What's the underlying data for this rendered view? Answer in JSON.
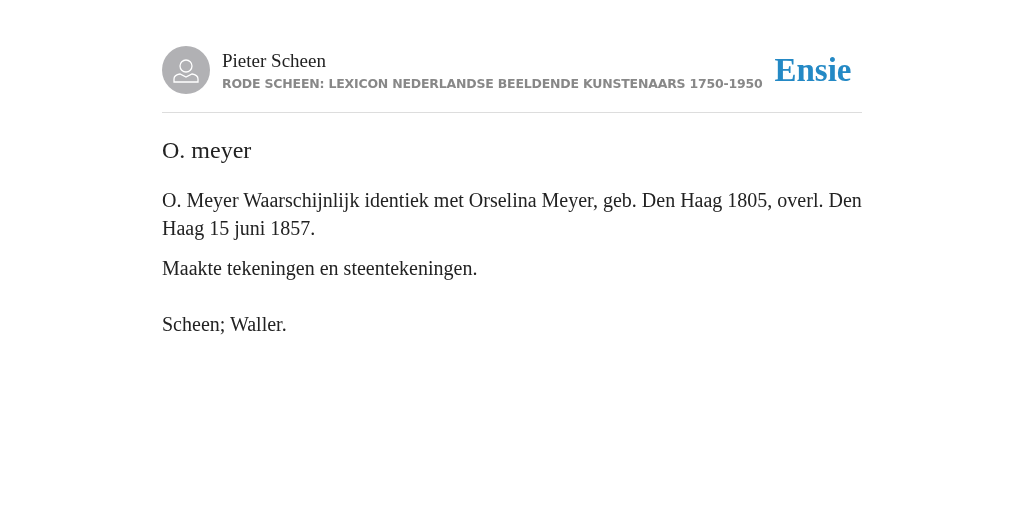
{
  "header": {
    "author": "Pieter Scheen",
    "source": "RODE SCHEEN: LEXICON NEDERLANDSE BEELDENDE KUNSTENAARS 1750-1950",
    "logo": "Ensie"
  },
  "article": {
    "title": "O. meyer",
    "paragraphs": [
      "O. Meyer Waarschijnlijk identiek met Orselina Meyer, geb. Den Haag 1805, overl. Den Haag 15 juni 1857.",
      "Maakte tekeningen en steentekeningen."
    ],
    "references": "Scheen; Waller."
  }
}
